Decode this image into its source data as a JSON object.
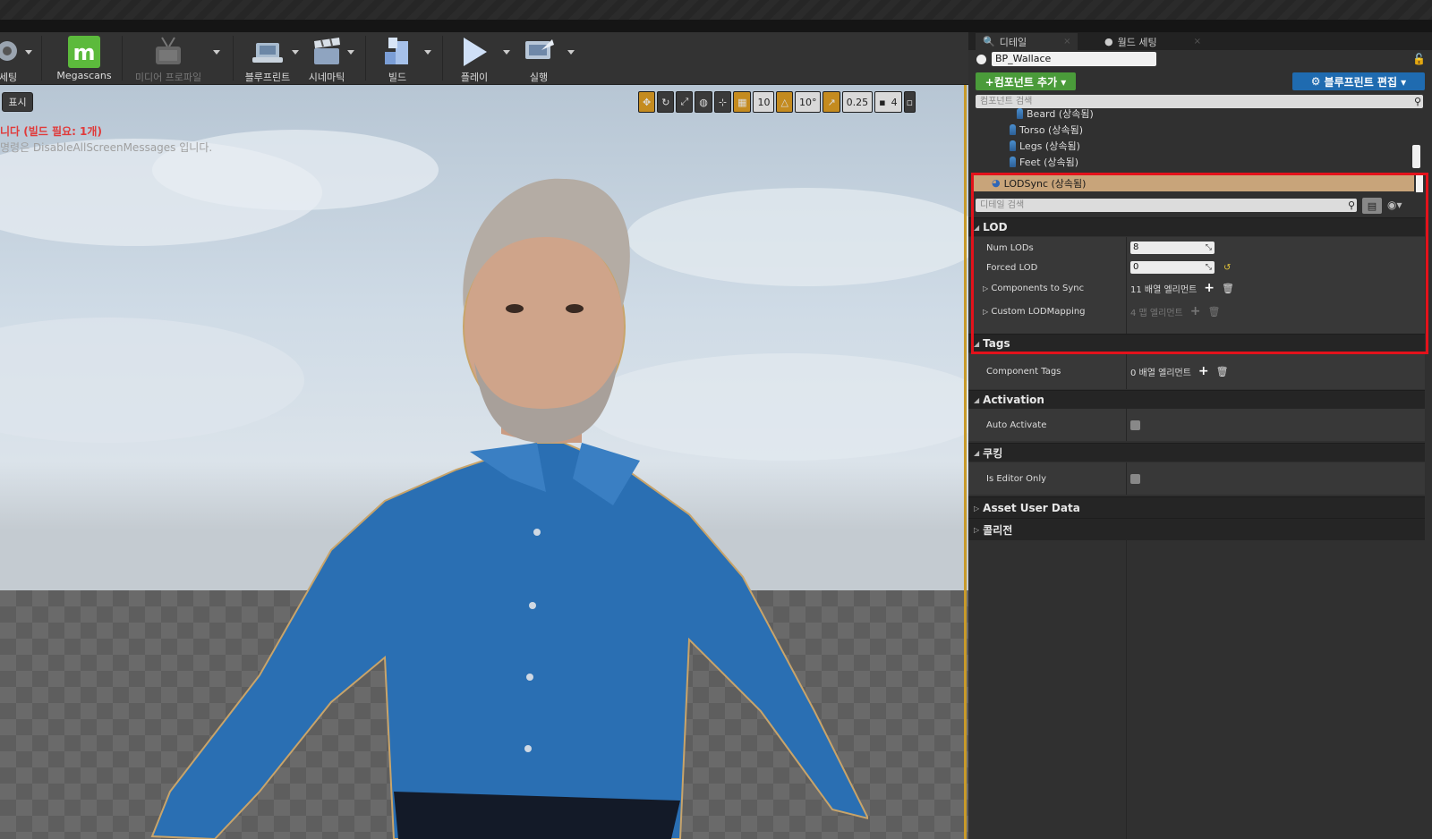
{
  "toolbar": {
    "settings_label": "세팅",
    "megascans_label": "Megascans",
    "media_profile_label": "미디어 프로파일",
    "blueprint_label": "블루프린트",
    "cinematic_label": "시네마틱",
    "build_label": "빌드",
    "play_label": "플레이",
    "launch_label": "실행"
  },
  "viewport": {
    "show_label": "표시",
    "message_red": "니다 (빌드 필요: 1개)",
    "message_grey": "명령은 DisableAllScreenMessages 입니다.",
    "grid_snap": "10",
    "rotation_snap": "10°",
    "scale_snap": "0.25",
    "camera_speed": "4"
  },
  "details": {
    "tab_details": "디테일",
    "tab_world_settings": "월드 세팅",
    "blueprint_name": "BP_Wallace",
    "add_component": "+컴포넌트 추가 ▾",
    "edit_blueprint": "블루프린트 편집 ▾",
    "component_search_placeholder": "컴포넌트 검색",
    "tree": [
      {
        "label": "Beard (상속됨)"
      },
      {
        "label": "Torso (상속됨)"
      },
      {
        "label": "Legs (상속됨)"
      },
      {
        "label": "Feet (상속됨)"
      }
    ],
    "selected_component": "LODSync (상속됨)",
    "detail_search_placeholder": "디테일 검색",
    "sections": {
      "lod": "LOD",
      "tags": "Tags",
      "activation": "Activation",
      "cooking": "쿠킹",
      "asset_user_data": "Asset User Data",
      "collision": "콜리전"
    },
    "props": {
      "num_lods_label": "Num LODs",
      "num_lods_value": "8",
      "forced_lod_label": "Forced LOD",
      "forced_lod_value": "0",
      "components_to_sync_label": "Components to Sync",
      "components_to_sync_value": "11 배열 엘리먼트",
      "custom_lod_mapping_label": "Custom LODMapping",
      "custom_lod_mapping_value": "4 맵 엘리먼트",
      "component_tags_label": "Component Tags",
      "component_tags_value": "0 배열 엘리먼트",
      "auto_activate_label": "Auto Activate",
      "is_editor_only_label": "Is Editor Only"
    }
  },
  "colors": {
    "add_component_green": "#4a9b3a",
    "edit_blueprint_blue": "#1f6bb0",
    "selection_tan": "#c8a47a",
    "highlight_red": "#e3121b",
    "viewport_border_orange": "#c89a2a"
  }
}
